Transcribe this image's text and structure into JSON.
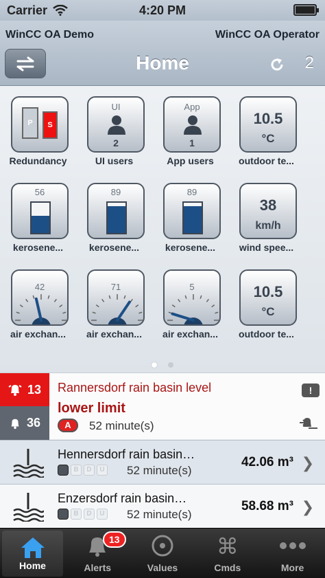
{
  "status_bar": {
    "carrier": "Carrier",
    "time": "4:20 PM"
  },
  "header": {
    "left_title": "WinCC OA Demo",
    "right_title": "WinCC OA Operator",
    "page_title": "Home",
    "count": "2"
  },
  "tiles": [
    {
      "label": "Redundancy",
      "p": "P",
      "s": "S"
    },
    {
      "label": "UI users",
      "top": "UI",
      "value": "2"
    },
    {
      "label": "App users",
      "top": "App",
      "value": "1"
    },
    {
      "label": "outdoor te...",
      "value": "10.5",
      "unit": "°C"
    },
    {
      "label": "kerosene...",
      "value": "56",
      "level": 0.56
    },
    {
      "label": "kerosene...",
      "value": "89",
      "level": 0.89
    },
    {
      "label": "kerosene...",
      "value": "89",
      "level": 0.89
    },
    {
      "label": "wind spee...",
      "value": "38",
      "unit": "km/h"
    },
    {
      "label": "air exchan...",
      "value": "42",
      "gauge": 42
    },
    {
      "label": "air exchan...",
      "value": "71",
      "gauge": 71
    },
    {
      "label": "air exchan...",
      "value": "5",
      "gauge": 5
    },
    {
      "label": "outdoor te...",
      "value": "10.5",
      "unit": "°C"
    }
  ],
  "alert": {
    "count_red": "13",
    "count_grey": "36",
    "title": "Rannersdorf rain basin level",
    "subtitle": "lower limit",
    "chip": "A",
    "time": "52 minute(s)",
    "excl": "!"
  },
  "rows": [
    {
      "name": "Hennersdorf rain basin…",
      "flags": [
        "B",
        "D",
        "U"
      ],
      "time": "52 minute(s)",
      "value": "42.06 m³"
    },
    {
      "name": "Enzersdorf rain basin…",
      "flags": [
        "B",
        "D",
        "U"
      ],
      "time": "52 minute(s)",
      "value": "58.68 m³"
    }
  ],
  "tabs": [
    {
      "label": "Home",
      "icon": "home-icon"
    },
    {
      "label": "Alerts",
      "icon": "bell-icon",
      "badge": "13"
    },
    {
      "label": "Values",
      "icon": "target-icon"
    },
    {
      "label": "Cmds",
      "icon": "command-icon"
    },
    {
      "label": "More",
      "icon": "more-icon"
    }
  ],
  "colors": {
    "accent_red": "#e51616",
    "tank_fill": "#1d4f87",
    "tab_active_blue": "#3aa0f0"
  }
}
